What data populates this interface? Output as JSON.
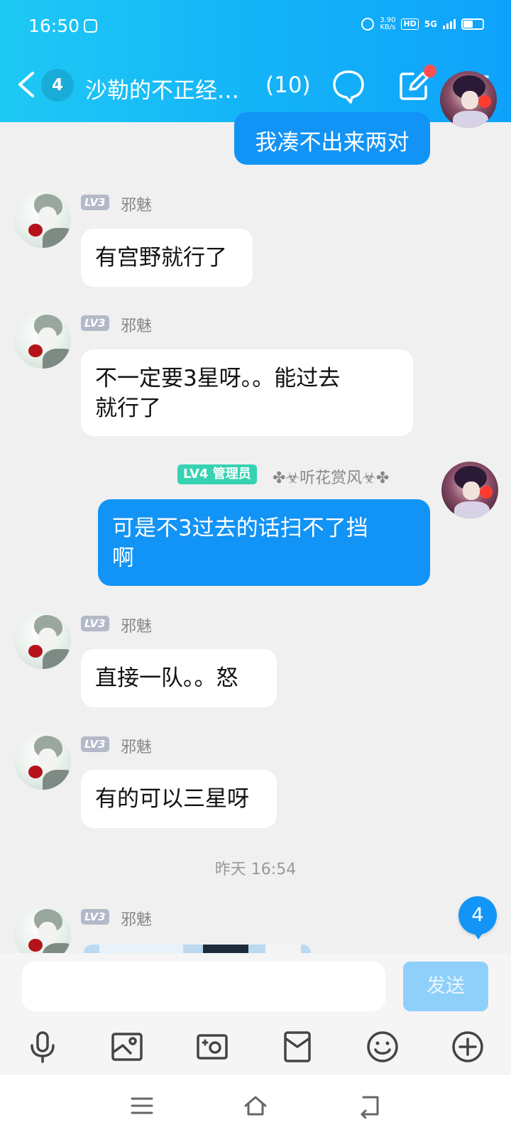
{
  "status_bar": {
    "time": "16:50",
    "net_speed_value": "3.90",
    "net_speed_unit": "KB/s",
    "hd": "HD",
    "network": "5G",
    "battery_level": 0.55,
    "icons": [
      "gallery-app-icon",
      "alarm-icon",
      "signal-icon",
      "battery-icon"
    ]
  },
  "header": {
    "unread_count": "4",
    "title": "沙勒的不正经…",
    "member_count": "(10)",
    "icons": [
      "back-icon",
      "chat-bubble-icon",
      "edit-icon",
      "menu-icon"
    ],
    "accent": "#14b4f8"
  },
  "messages": [
    {
      "text": "我凑不出来两对",
      "direction": "out"
    },
    {
      "level": "LV3",
      "sender": "邪魅",
      "text": "有宫野就行了",
      "direction": "in"
    },
    {
      "level": "LV3",
      "sender": "邪魅",
      "text_line1": "不一定要3星呀。。能过去",
      "text_line2": "就行了",
      "direction": "in"
    },
    {
      "level": "LV4",
      "role": "管理员",
      "sender": "✤☣听花赏风☣✤",
      "text_line1": "可是不3过去的话扫不了挡",
      "text_line2": "啊",
      "direction": "out"
    },
    {
      "level": "LV3",
      "sender": "邪魅",
      "text": "直接一队。。怒",
      "direction": "in"
    },
    {
      "level": "LV3",
      "sender": "邪魅",
      "text": "有的可以三星呀",
      "direction": "in"
    },
    {
      "level": "LV3",
      "sender": "邪魅",
      "direction": "in",
      "content": "image"
    }
  ],
  "timestamp": "昨天 16:54",
  "new_message_count": "4",
  "input_bar": {
    "placeholder": "",
    "send_label": "发送",
    "tools": [
      "microphone-icon",
      "image-icon",
      "camera-icon",
      "red-packet-icon",
      "emoji-icon",
      "plus-icon"
    ]
  },
  "system_nav": [
    "recent-apps-icon",
    "home-icon",
    "back-nav-icon"
  ],
  "colors": {
    "bubble_out": "#1293f6",
    "bubble_in": "#ffffff",
    "background": "#f0f0f0",
    "admin_badge": "#37d2b2"
  }
}
